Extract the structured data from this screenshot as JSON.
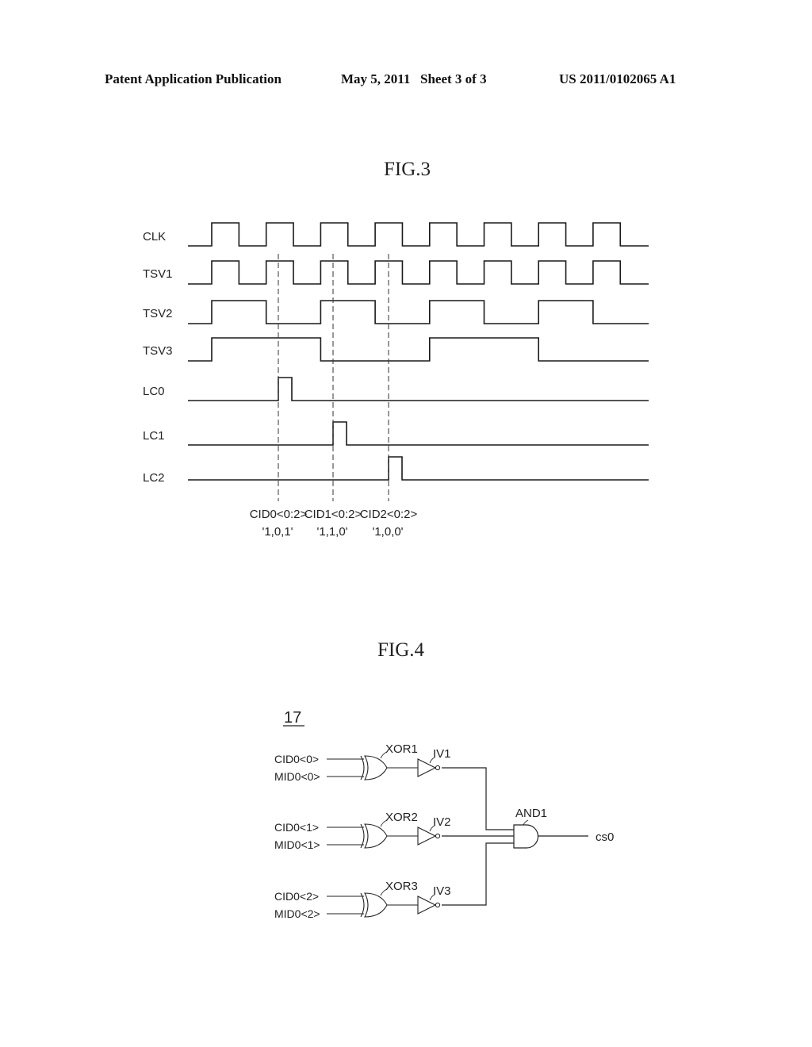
{
  "header": {
    "publication": "Patent Application Publication",
    "date": "May 5, 2011",
    "sheet": "Sheet 3 of 3",
    "number": "US 2011/0102065 A1"
  },
  "fig3": {
    "title": "FIG.3",
    "signals": [
      {
        "name": "CLK",
        "transitions_cycles": "toggle every half cycle",
        "levels": [
          0,
          1,
          0,
          1,
          0,
          1,
          0,
          1,
          0,
          1,
          0,
          1,
          0,
          1,
          0,
          1,
          0
        ]
      },
      {
        "name": "TSV1",
        "levels": [
          0,
          1,
          0,
          1,
          0,
          1,
          0,
          1,
          0,
          1,
          0,
          1,
          0,
          1,
          0,
          1,
          0
        ]
      },
      {
        "name": "TSV2",
        "levels": [
          0,
          1,
          1,
          0,
          0,
          1,
          1,
          0,
          0,
          1,
          1,
          0,
          0,
          1,
          1,
          0,
          0
        ]
      },
      {
        "name": "TSV3",
        "levels": [
          0,
          1,
          1,
          1,
          1,
          0,
          0,
          0,
          0,
          1,
          1,
          1,
          1,
          0,
          0,
          0,
          0
        ]
      },
      {
        "name": "LC0",
        "pulse_at_marker": 0
      },
      {
        "name": "LC1",
        "pulse_at_marker": 1
      },
      {
        "name": "LC2",
        "pulse_at_marker": 2
      }
    ],
    "markers": [
      {
        "label": "CID0<0:2>",
        "value": "'1,0,1'"
      },
      {
        "label": "CID1<0:2>",
        "value": "'1,1,0'"
      },
      {
        "label": "CID2<0:2>",
        "value": "'1,0,0'"
      }
    ]
  },
  "fig4": {
    "title": "FIG.4",
    "ref_number": "17",
    "stages": [
      {
        "xor": "XOR1",
        "inverter": "IV1",
        "inputs": [
          "CID0<0>",
          "MID0<0>"
        ]
      },
      {
        "xor": "XOR2",
        "inverter": "IV2",
        "inputs": [
          "CID0<1>",
          "MID0<1>"
        ]
      },
      {
        "xor": "XOR3",
        "inverter": "IV3",
        "inputs": [
          "CID0<2>",
          "MID0<2>"
        ]
      }
    ],
    "and_gate": "AND1",
    "output": "cs0"
  }
}
